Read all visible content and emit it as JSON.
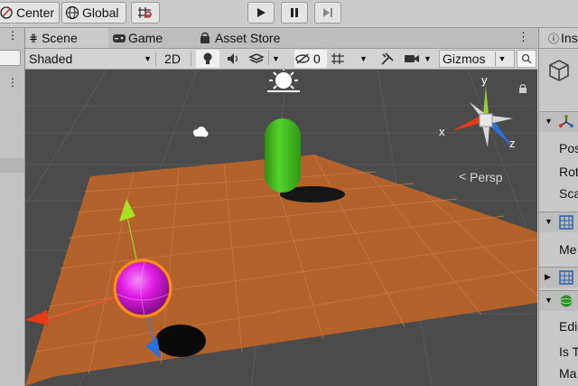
{
  "toolbar": {
    "pivot_label": "Center",
    "space_label": "Global",
    "play_icon": "play-icon",
    "pause_icon": "pause-icon",
    "step_icon": "step-icon"
  },
  "tabs": [
    {
      "label": "Scene",
      "icon": "grid-icon"
    },
    {
      "label": "Game",
      "icon": "game-icon"
    },
    {
      "label": "Asset Store",
      "icon": "store-icon"
    }
  ],
  "scene_toolbar": {
    "draw_mode": "Shaded",
    "mode_2d": "2D",
    "hidden_count": "0",
    "gizmos_label": "Gizmos"
  },
  "scene": {
    "persp_label": "Persp",
    "axis_x": "x",
    "axis_y": "y",
    "axis_z": "z"
  },
  "inspector": {
    "tab_label": "Ins",
    "rows": [
      "Pos",
      "Rot",
      "Sca",
      "Me",
      "Edi",
      "Is T",
      "Ma"
    ]
  },
  "colors": {
    "plane": "#b3622c",
    "capsule": "#47c21c",
    "sphere": "#e11be5",
    "viewport_bg": "#4b4b4b"
  }
}
